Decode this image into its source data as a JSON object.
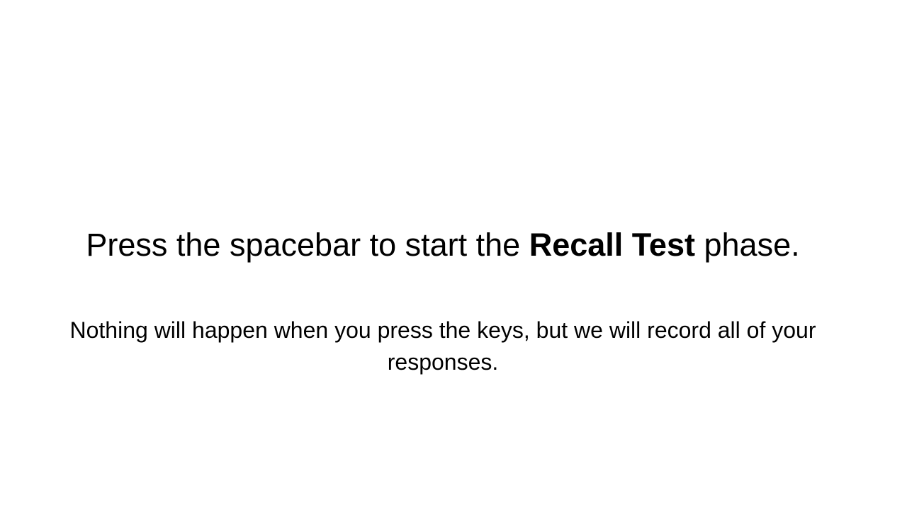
{
  "instruction": {
    "prefix": "Press the spacebar to start the ",
    "emphasis": "Recall Test",
    "suffix": " phase."
  },
  "note": "Nothing will happen when you press the keys, but we will record all of your responses."
}
